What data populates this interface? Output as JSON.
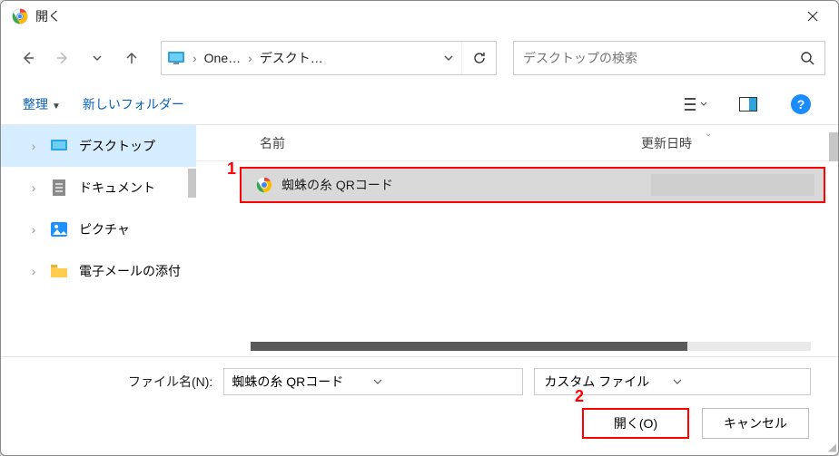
{
  "title": "開く",
  "breadcrumb": {
    "seg1": "One…",
    "seg2": "デスクト…"
  },
  "search": {
    "placeholder": "デスクトップの検索"
  },
  "toolbar": {
    "organize": "整理",
    "newfolder": "新しいフォルダー"
  },
  "sidebar": {
    "items": [
      {
        "label": "デスクトップ"
      },
      {
        "label": "ドキュメント"
      },
      {
        "label": "ピクチャ"
      },
      {
        "label": "電子メールの添付"
      }
    ]
  },
  "columns": {
    "name": "名前",
    "date": "更新日時"
  },
  "files": [
    {
      "name": "蜘蛛の糸 QRコード"
    }
  ],
  "annotations": {
    "a1": "1",
    "a2": "2"
  },
  "bottom": {
    "label": "ファイル名(N):",
    "value": "蜘蛛の糸 QRコード",
    "filter": "カスタム ファイル",
    "open": "開く(O)",
    "cancel": "キャンセル"
  }
}
